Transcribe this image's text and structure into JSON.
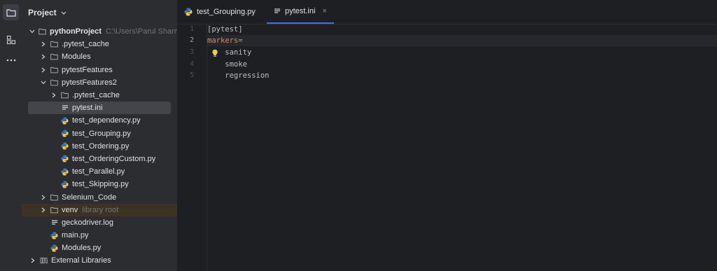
{
  "project_panel": {
    "title": "Project",
    "tree": [
      {
        "label": "pythonProject",
        "hint": "C:\\Users\\Parul Sharma",
        "type": "folder",
        "depth": 0,
        "expanded": true
      },
      {
        "label": ".pytest_cache",
        "type": "folder",
        "depth": 1,
        "expanded": false
      },
      {
        "label": "Modules",
        "type": "folder",
        "depth": 1,
        "expanded": false
      },
      {
        "label": "pytestFeatures",
        "type": "folder",
        "depth": 1,
        "expanded": false
      },
      {
        "label": "pytestFeatures2",
        "type": "folder",
        "depth": 1,
        "expanded": true
      },
      {
        "label": ".pytest_cache",
        "type": "folder",
        "depth": 2,
        "expanded": false
      },
      {
        "label": "pytest.ini",
        "type": "text-file",
        "depth": 2,
        "selected": true
      },
      {
        "label": "test_dependency.py",
        "type": "python-file",
        "depth": 2
      },
      {
        "label": "test_Grouping.py",
        "type": "python-file",
        "depth": 2
      },
      {
        "label": "test_Ordering.py",
        "type": "python-file",
        "depth": 2
      },
      {
        "label": "test_OrderingCustom.py",
        "type": "python-file",
        "depth": 2
      },
      {
        "label": "test_Parallel.py",
        "type": "python-file",
        "depth": 2
      },
      {
        "label": "test_Skipping.py",
        "type": "python-file",
        "depth": 2
      },
      {
        "label": "Selenium_Code",
        "type": "folder",
        "depth": 1,
        "expanded": false
      },
      {
        "label": "venv",
        "hint": "library root",
        "type": "folder",
        "depth": 1,
        "expanded": false,
        "excluded": true
      },
      {
        "label": "geckodriver.log",
        "type": "text-file",
        "depth": 1
      },
      {
        "label": "main.py",
        "type": "python-file",
        "depth": 1
      },
      {
        "label": "Modules.py",
        "type": "python-file",
        "depth": 1
      },
      {
        "label": "External Libraries",
        "type": "library",
        "depth": 0,
        "expanded": false
      }
    ]
  },
  "tabs": [
    {
      "label": "test_Grouping.py",
      "icon": "python-file-icon",
      "active": false
    },
    {
      "label": "pytest.ini",
      "icon": "text-file-icon",
      "active": true,
      "close": "×"
    }
  ],
  "editor": {
    "line_numbers": [
      "1",
      "2",
      "3",
      "4",
      "5"
    ],
    "current_line": "2",
    "lines": [
      {
        "text": "[pytest]",
        "kind": "plain"
      },
      {
        "text": "markers=",
        "kind": "key"
      },
      {
        "text": "    sanity",
        "kind": "plain"
      },
      {
        "text": "    smoke",
        "kind": "plain"
      },
      {
        "text": "    regression",
        "kind": "plain"
      }
    ]
  },
  "colors": {
    "accent": "#3574f0",
    "key": "#cf8e6d",
    "folder": "#a0a4ab",
    "python_blue": "#3b79c2",
    "python_yellow": "#f2c94c",
    "bulb": "#f2c94c"
  }
}
